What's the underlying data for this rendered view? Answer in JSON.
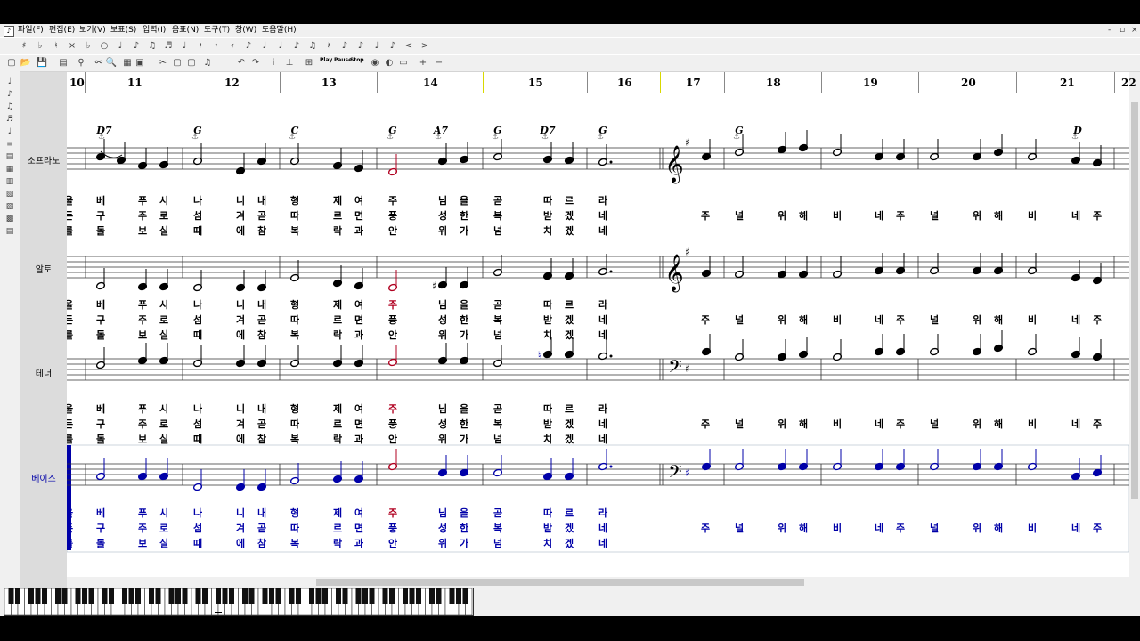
{
  "menu": [
    "파일(F)",
    "편집(E)",
    "보기(V)",
    "보표(S)",
    "입력(I)",
    "음표(N)",
    "도구(T)",
    "창(W)",
    "도움말(H)"
  ],
  "window_controls": [
    "-",
    "▫",
    "×"
  ],
  "toolbar2": {
    "play": "Play",
    "pause": "Pause",
    "stop": "Stop"
  },
  "measures": [
    "10",
    "11",
    "12",
    "13",
    "14",
    "15",
    "16",
    "17",
    "18",
    "19",
    "20",
    "21",
    "22"
  ],
  "chords": [
    {
      "m": 11,
      "t": "D7"
    },
    {
      "m": 12,
      "t": "G"
    },
    {
      "m": 13,
      "t": "C"
    },
    {
      "m": 14,
      "t": "G"
    },
    {
      "m": 14.5,
      "t": "A7"
    },
    {
      "m": 15,
      "t": "G"
    },
    {
      "m": 15.5,
      "t": "D7"
    },
    {
      "m": 16,
      "t": "G"
    },
    {
      "m": 18,
      "t": "G"
    },
    {
      "m": 21,
      "t": "D"
    }
  ],
  "tracks": [
    {
      "name": "소프라노",
      "active": false
    },
    {
      "name": "알토",
      "active": false
    },
    {
      "name": "테너",
      "active": false
    },
    {
      "name": "베이스",
      "active": true
    }
  ],
  "lyrics_a": {
    "v1": [
      "울",
      "베",
      "푸",
      "시",
      "나",
      "니",
      "내",
      "형",
      "제",
      "여",
      "주",
      "님",
      "을",
      "곧",
      "따",
      "르",
      "라"
    ],
    "v2": [
      "든",
      "구",
      "주",
      "로",
      "섬",
      "겨",
      "곧",
      "따",
      "르",
      "면",
      "풍",
      "성",
      "한",
      "복",
      "받",
      "겠",
      "네"
    ],
    "v3": [
      "를",
      "돌",
      "보",
      "실",
      "때",
      "에",
      "참",
      "복",
      "락",
      "과",
      "안",
      "위",
      "가",
      "넘",
      "치",
      "겠",
      "네"
    ]
  },
  "lyrics_b": [
    "주",
    "널",
    "위",
    "해",
    "비",
    "네",
    "주",
    "널",
    "위",
    "해",
    "비",
    "네",
    "주"
  ],
  "colors": {
    "accent": "#0000a8",
    "highlight": "#b00020",
    "note": "#000000"
  }
}
